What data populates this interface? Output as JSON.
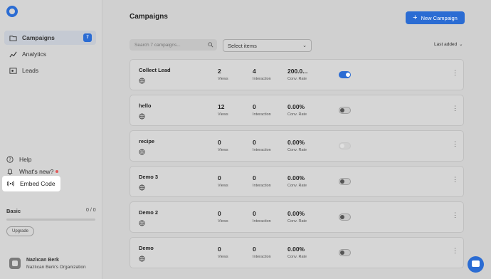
{
  "sidebar": {
    "items": [
      {
        "label": "Campaigns",
        "badge": "7",
        "icon": "folder-icon"
      },
      {
        "label": "Analytics",
        "icon": "trend-icon"
      },
      {
        "label": "Leads",
        "icon": "leads-icon"
      }
    ],
    "help_label": "Help",
    "whats_new_label": "What's new?",
    "embed_code_label": "Embed Code",
    "plan": {
      "name": "Basic",
      "usage": "0 / 0",
      "progress_fraction": 0
    },
    "upgrade_label": "Upgrade",
    "user": {
      "name": "Nazlıcan Berk",
      "org": "Nazlıcan Berk's Organization"
    }
  },
  "header": {
    "title": "Campaigns",
    "new_button_label": "New Campaign"
  },
  "toolbar": {
    "search_placeholder": "Search 7 campaigns...",
    "select_value": "Select items",
    "sort_value": "Last added"
  },
  "metric_labels": {
    "views": "Views",
    "interaction": "Interaction",
    "conv_rate": "Conv. Rate"
  },
  "campaigns": [
    {
      "name": "Collect Lead",
      "views": "2",
      "interaction": "4",
      "conv_rate": "200.0...",
      "toggle": "on"
    },
    {
      "name": "hello",
      "views": "12",
      "interaction": "0",
      "conv_rate": "0.00%",
      "toggle": "off"
    },
    {
      "name": "recipe",
      "views": "0",
      "interaction": "0",
      "conv_rate": "0.00%",
      "toggle": "disabled"
    },
    {
      "name": "Demo 3",
      "views": "0",
      "interaction": "0",
      "conv_rate": "0.00%",
      "toggle": "off"
    },
    {
      "name": "Demo 2",
      "views": "0",
      "interaction": "0",
      "conv_rate": "0.00%",
      "toggle": "off"
    },
    {
      "name": "Demo",
      "views": "0",
      "interaction": "0",
      "conv_rate": "0.00%",
      "toggle": "off"
    }
  ],
  "colors": {
    "accent": "#2b6cd3",
    "notification_dot": "#e05a5a",
    "overlay_bg": "#d0d0d0"
  }
}
